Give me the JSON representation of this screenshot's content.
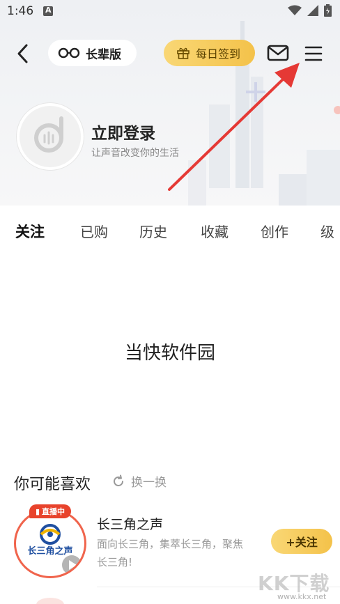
{
  "status_bar": {
    "time": "1:46"
  },
  "toolbar": {
    "elder_mode_label": "长辈版",
    "checkin_label": "每日签到"
  },
  "profile": {
    "login_title": "立即登录",
    "login_subtitle": "让声音改变你的生活"
  },
  "tabs": [
    {
      "label": "关注",
      "active": true
    },
    {
      "label": "已购",
      "active": false
    },
    {
      "label": "历史",
      "active": false
    },
    {
      "label": "收藏",
      "active": false
    },
    {
      "label": "创作",
      "active": false
    },
    {
      "label": "级",
      "active": false
    }
  ],
  "watermark_center": "当快软件园",
  "recommend": {
    "title": "你可能喜欢",
    "refresh_label": "换一换",
    "items": [
      {
        "badge": "直播中",
        "cover_text": "长三角之声",
        "title": "长三角之声",
        "description": "面向长三角，集萃长三角，聚焦长三角!",
        "follow_label": "+关注"
      }
    ]
  },
  "site_watermark": {
    "logo": "KK下载",
    "url": "www.kkx.net"
  },
  "colors": {
    "accent_yellow": "#f4c24a",
    "live_red": "#e8432c",
    "annotation_red": "#e53935"
  }
}
